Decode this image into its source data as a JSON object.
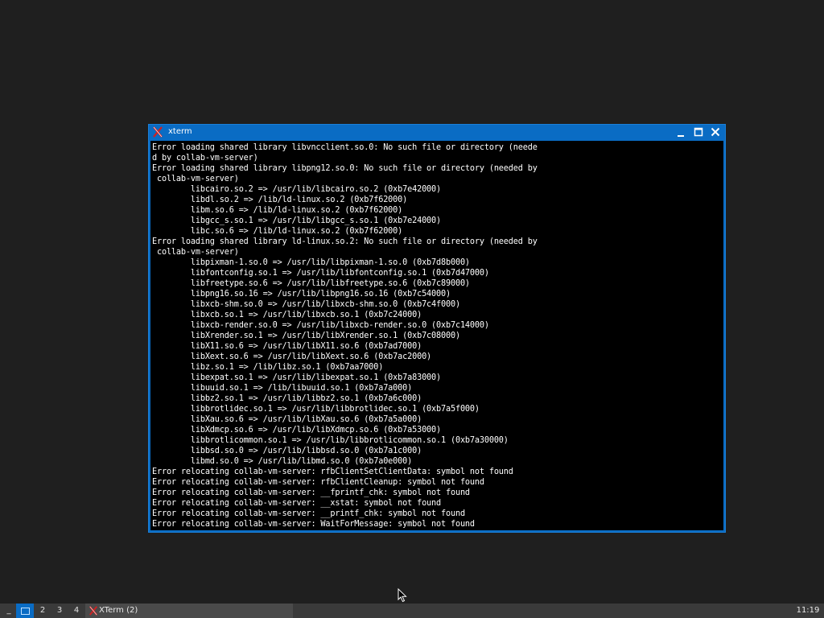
{
  "window": {
    "title": "xterm"
  },
  "terminal": {
    "lines": [
      "Error loading shared library libvncclient.so.0: No such file or directory (neede",
      "d by collab-vm-server)",
      "Error loading shared library libpng12.so.0: No such file or directory (needed by",
      " collab-vm-server)",
      "        libcairo.so.2 => /usr/lib/libcairo.so.2 (0xb7e42000)",
      "        libdl.so.2 => /lib/ld-linux.so.2 (0xb7f62000)",
      "        libm.so.6 => /lib/ld-linux.so.2 (0xb7f62000)",
      "        libgcc_s.so.1 => /usr/lib/libgcc_s.so.1 (0xb7e24000)",
      "        libc.so.6 => /lib/ld-linux.so.2 (0xb7f62000)",
      "Error loading shared library ld-linux.so.2: No such file or directory (needed by",
      " collab-vm-server)",
      "        libpixman-1.so.0 => /usr/lib/libpixman-1.so.0 (0xb7d8b000)",
      "        libfontconfig.so.1 => /usr/lib/libfontconfig.so.1 (0xb7d47000)",
      "        libfreetype.so.6 => /usr/lib/libfreetype.so.6 (0xb7c89000)",
      "        libpng16.so.16 => /usr/lib/libpng16.so.16 (0xb7c54000)",
      "        libxcb-shm.so.0 => /usr/lib/libxcb-shm.so.0 (0xb7c4f000)",
      "        libxcb.so.1 => /usr/lib/libxcb.so.1 (0xb7c24000)",
      "        libxcb-render.so.0 => /usr/lib/libxcb-render.so.0 (0xb7c14000)",
      "        libXrender.so.1 => /usr/lib/libXrender.so.1 (0xb7c08000)",
      "        libX11.so.6 => /usr/lib/libX11.so.6 (0xb7ad7000)",
      "        libXext.so.6 => /usr/lib/libXext.so.6 (0xb7ac2000)",
      "        libz.so.1 => /lib/libz.so.1 (0xb7aa7000)",
      "        libexpat.so.1 => /usr/lib/libexpat.so.1 (0xb7a83000)",
      "        libuuid.so.1 => /lib/libuuid.so.1 (0xb7a7a000)",
      "        libbz2.so.1 => /usr/lib/libbz2.so.1 (0xb7a6c000)",
      "        libbrotlidec.so.1 => /usr/lib/libbrotlidec.so.1 (0xb7a5f000)",
      "        libXau.so.6 => /usr/lib/libXau.so.6 (0xb7a5a000)",
      "        libXdmcp.so.6 => /usr/lib/libXdmcp.so.6 (0xb7a53000)",
      "        libbrotlicommon.so.1 => /usr/lib/libbrotlicommon.so.1 (0xb7a30000)",
      "        libbsd.so.0 => /usr/lib/libbsd.so.0 (0xb7a1c000)",
      "        libmd.so.0 => /usr/lib/libmd.so.0 (0xb7a0e000)",
      "Error relocating collab-vm-server: rfbClientSetClientData: symbol not found",
      "Error relocating collab-vm-server: rfbClientCleanup: symbol not found",
      "Error relocating collab-vm-server: __fprintf_chk: symbol not found",
      "Error relocating collab-vm-server: __xstat: symbol not found",
      "Error relocating collab-vm-server: __printf_chk: symbol not found",
      "Error relocating collab-vm-server: WaitForMessage: symbol not found"
    ]
  },
  "taskbar": {
    "menu_label": "_",
    "workspaces": [
      "1",
      "2",
      "3",
      "4"
    ],
    "active_workspace": "1",
    "task_label": "XTerm (2)",
    "clock": "11:19"
  },
  "colors": {
    "desktop": "#1f1f1f",
    "window_border": "#0a6cc4",
    "terminal_bg": "#000000",
    "terminal_fg": "#ffffff",
    "taskbar": "#3a3a3a"
  },
  "icons": {
    "window": "xterm-x-icon",
    "minimize": "minimize-icon",
    "maximize": "maximize-icon",
    "close": "close-icon",
    "cursor": "mouse-pointer-icon"
  }
}
